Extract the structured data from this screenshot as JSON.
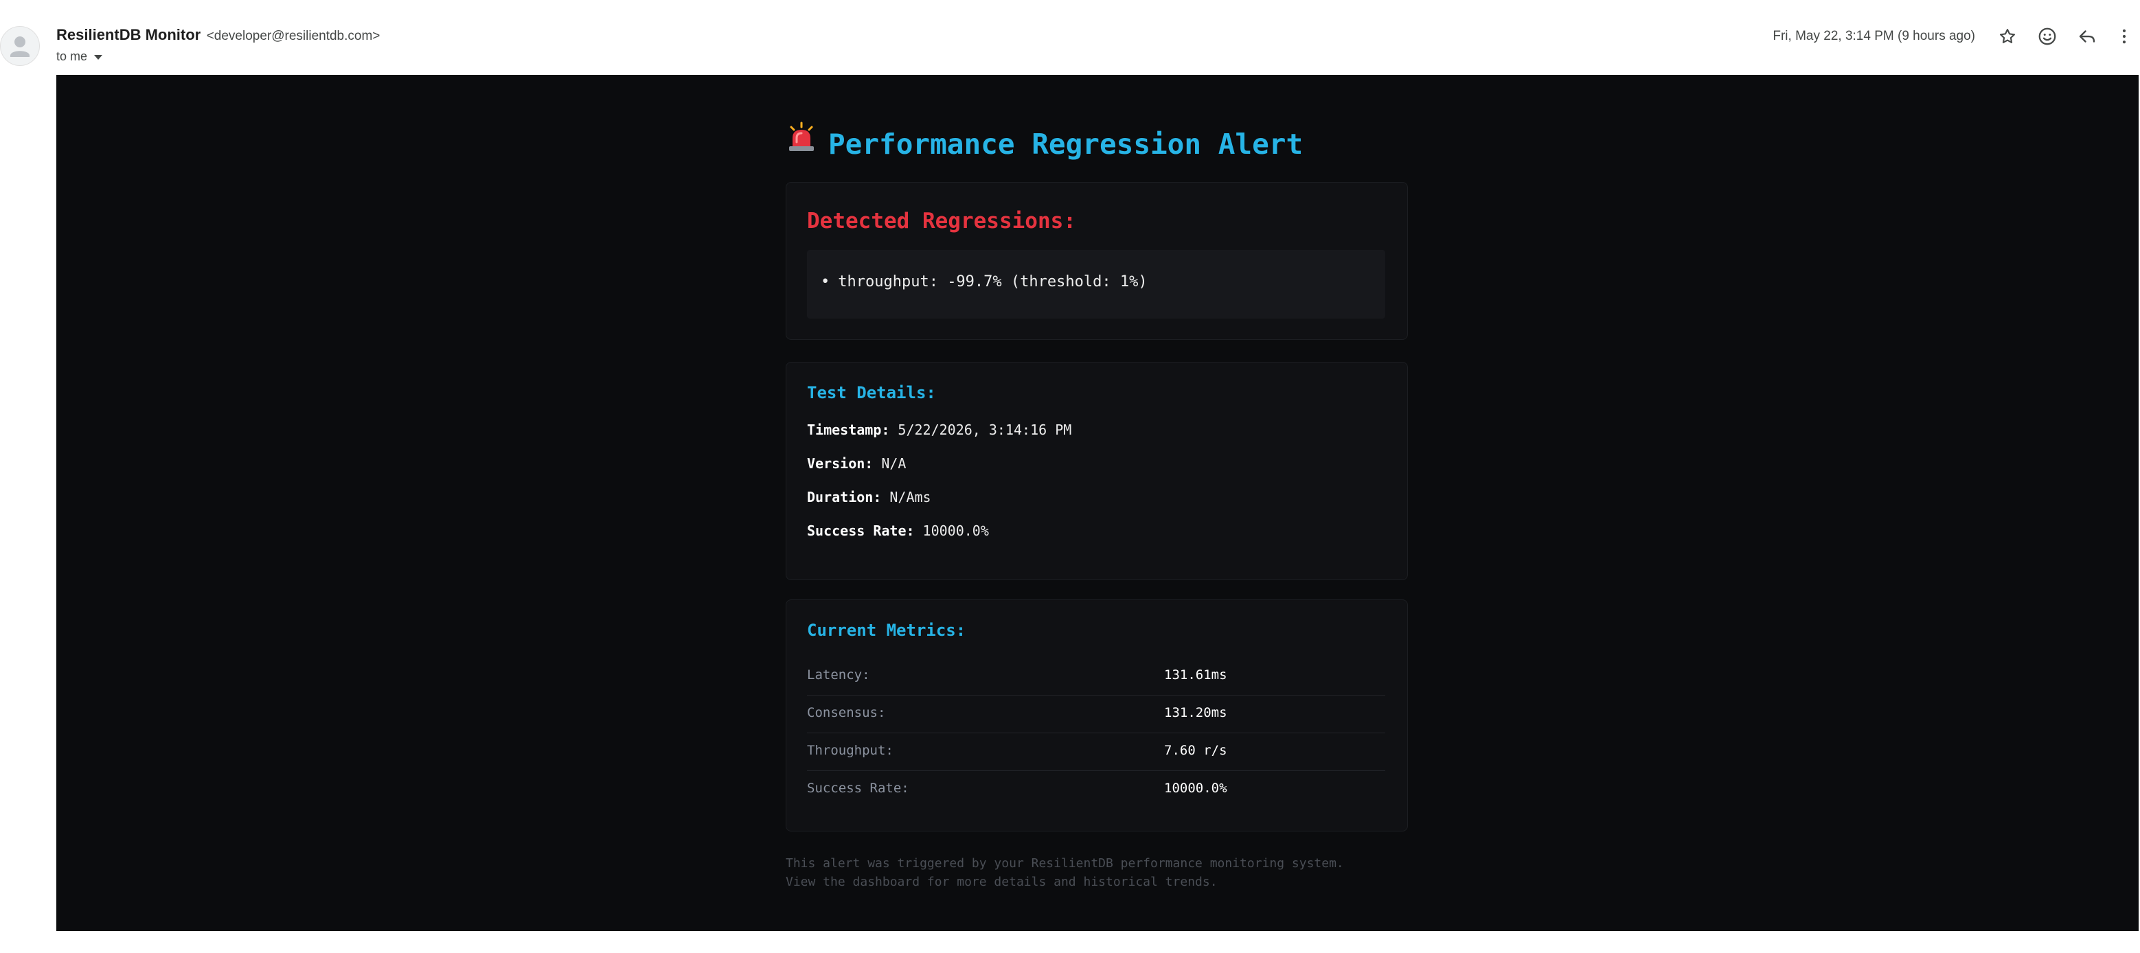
{
  "header": {
    "sender_name": "ResilientDB Monitor",
    "sender_email": "<developer@resilientdb.com>",
    "recipient": "to me",
    "date": "Fri, May 22, 3:14 PM (9 hours ago)",
    "icons": [
      "avatar-icon",
      "star-icon",
      "emoji-icon",
      "reply-icon",
      "more-vert-icon"
    ]
  },
  "email": {
    "title": "Performance Regression Alert",
    "title_icon": "siren-icon",
    "regressions": {
      "heading": "Detected Regressions:",
      "items": [
        "throughput: -99.7% (threshold: 1%)"
      ]
    },
    "details": {
      "heading": "Test Details:",
      "rows": [
        {
          "label": "Timestamp:",
          "value": "5/22/2026, 3:14:16 PM"
        },
        {
          "label": "Version:",
          "value": "N/A"
        },
        {
          "label": "Duration:",
          "value": "N/Ams"
        },
        {
          "label": "Success Rate:",
          "value": "10000.0%"
        }
      ]
    },
    "metrics": {
      "heading": "Current Metrics:",
      "rows": [
        {
          "label": "Latency:",
          "value": "131.61ms"
        },
        {
          "label": "Consensus:",
          "value": "131.20ms"
        },
        {
          "label": "Throughput:",
          "value": "7.60 r/s"
        },
        {
          "label": "Success Rate:",
          "value": "10000.0%"
        }
      ]
    },
    "footer": [
      "This alert was triggered by your ResilientDB performance monitoring system.",
      "View the dashboard for more details and historical trends."
    ]
  },
  "colors": {
    "accent": "#27b4e6",
    "alert": "#e5333f",
    "background": "#0b0c0e"
  }
}
